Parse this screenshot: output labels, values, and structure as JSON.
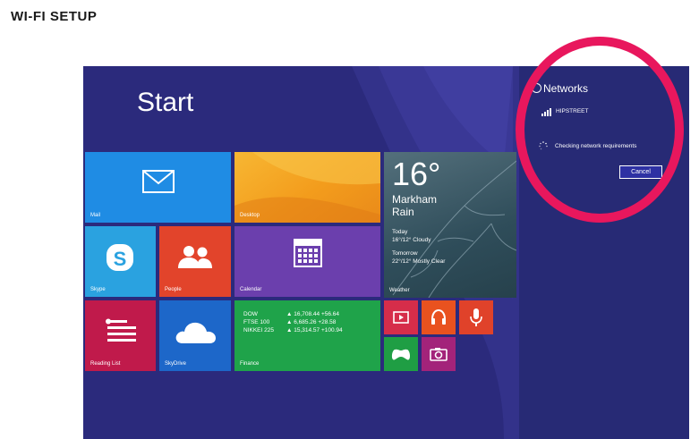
{
  "document": {
    "title": "WI-FI SETUP"
  },
  "start_screen": {
    "title": "Start",
    "tiles": {
      "mail": {
        "label": "Mail",
        "icon": "mail-icon"
      },
      "desktop": {
        "label": "Desktop"
      },
      "skype": {
        "label": "Skype",
        "icon": "skype-icon"
      },
      "people": {
        "label": "People",
        "icon": "people-icon"
      },
      "calendar": {
        "label": "Calendar",
        "icon": "calendar-icon"
      },
      "reading_list": {
        "label": "Reading List",
        "icon": "reading-list-icon"
      },
      "skydrive": {
        "label": "SkyDrive",
        "icon": "cloud-icon"
      },
      "weather": {
        "label": "Weather",
        "temperature": "16°",
        "city": "Markham",
        "condition": "Rain",
        "today_label": "Today",
        "today_forecast": "16°/12° Cloudy",
        "tomorrow_label": "Tomorrow",
        "tomorrow_forecast": "22°/12° Mostly Clear"
      },
      "finance": {
        "label": "Finance",
        "rows": [
          {
            "name": "DOW",
            "value": "▲ 16,708.44 +56.64"
          },
          {
            "name": "FTSE 100",
            "value": "▲ 6,685.26 +28.58"
          },
          {
            "name": "NIKKEI 225",
            "value": "▲ 15,314.57 +100.94"
          }
        ]
      },
      "video": {
        "icon": "video-icon"
      },
      "music": {
        "icon": "headphones-icon"
      },
      "voice": {
        "icon": "microphone-icon"
      },
      "games": {
        "icon": "gamepad-icon"
      },
      "camera": {
        "icon": "camera-icon"
      }
    }
  },
  "networks_panel": {
    "title": "Networks",
    "network_name": "HIPSTREET",
    "status_text": "Checking network requirements",
    "cancel_label": "Cancel"
  },
  "colors": {
    "background": "#2b2a7c",
    "highlight_ring": "#e8175d",
    "mail": "#1f8ce4",
    "desktop": "#f5a623",
    "skype": "#2aa2e0",
    "people": "#e2442b",
    "calendar": "#6b3fad",
    "reading_list": "#c01a4b",
    "skydrive": "#1d67c9",
    "finance": "#1fa34a"
  }
}
